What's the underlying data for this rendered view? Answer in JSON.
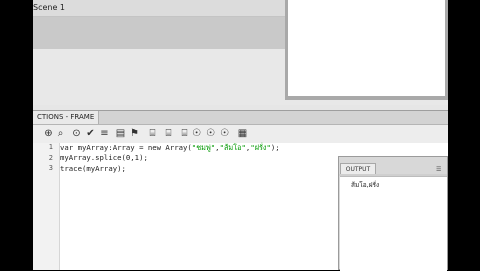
{
  "scene": {
    "label": "Scene 1"
  },
  "actions_panel": {
    "tab_label": "CTIONS - FRAME"
  },
  "toolbar": {
    "buttons": [
      {
        "icon": "add-statement-icon",
        "glyph": "⊕"
      },
      {
        "icon": "find-icon",
        "glyph": "⌕"
      },
      {
        "icon": "insert-target-path-icon",
        "glyph": "⊙"
      },
      {
        "icon": "check-syntax-icon",
        "glyph": "✔"
      },
      {
        "icon": "auto-format-icon",
        "glyph": "≡"
      },
      {
        "icon": "code-hint-icon",
        "glyph": "▤"
      },
      {
        "icon": "debug-options-icon",
        "glyph": "⚑"
      },
      {
        "icon": "collapse-between-braces-icon",
        "glyph": "⌸"
      },
      {
        "icon": "collapse-selection-icon",
        "glyph": "⌸"
      },
      {
        "icon": "expand-all-icon",
        "glyph": "⌸"
      },
      {
        "icon": "apply-block-comment-icon",
        "glyph": "☉"
      },
      {
        "icon": "apply-line-comment-icon",
        "glyph": "☉"
      },
      {
        "icon": "remove-comment-icon",
        "glyph": "☉"
      },
      {
        "icon": "show-toolbox-icon",
        "glyph": "▦"
      }
    ]
  },
  "editor": {
    "line_numbers": [
      "1",
      "2",
      "3"
    ],
    "lines": [
      {
        "pre": "var myArray:Array = new Array(",
        "s1": "\"ชมพู่\"",
        "c1": ",",
        "s2": "\"ส้มโอ\"",
        "c2": ",",
        "s3": "\"ฝรั่ง\"",
        "post": ");"
      },
      {
        "text": "myArray.splice(0,1);"
      },
      {
        "text": "trace(myArray);"
      }
    ]
  },
  "output_panel": {
    "tab_label": "OUTPUT",
    "text": "ส้มโอ,ฝรั่ง"
  }
}
